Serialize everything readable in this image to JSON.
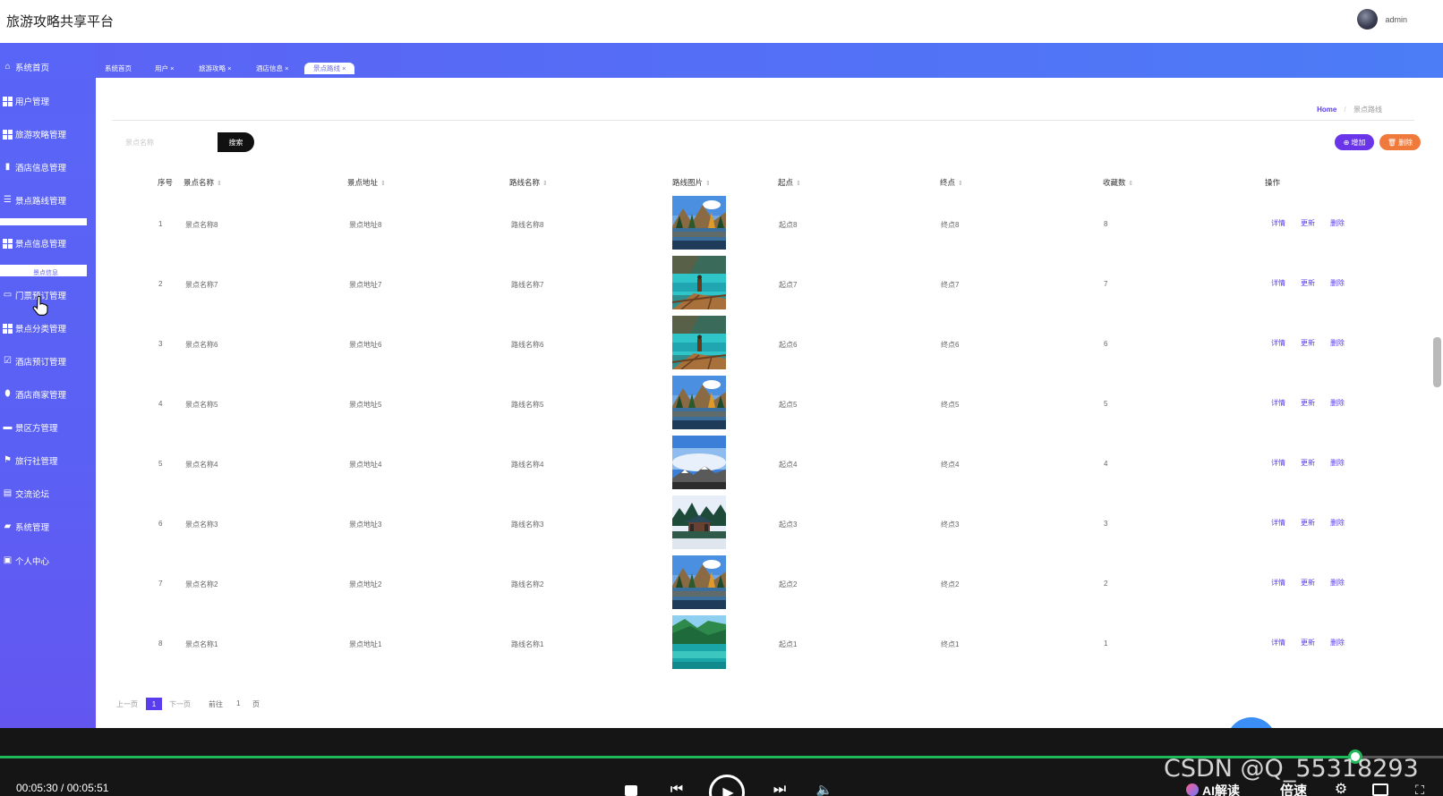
{
  "app": {
    "title": "旅游攻略共享平台",
    "user": "admin"
  },
  "sidebar": {
    "items": [
      {
        "label": "系统首页",
        "icon": "home-icon"
      },
      {
        "label": "用户管理",
        "icon": "grid-icon"
      },
      {
        "label": "旅游攻略管理",
        "icon": "grid-icon"
      },
      {
        "label": "酒店信息管理",
        "icon": "bar-chart-icon"
      },
      {
        "label": "景点路线管理",
        "icon": "list-icon"
      },
      {
        "label": "景点信息管理",
        "icon": "grid-icon"
      },
      {
        "label": "门票预订管理",
        "icon": "monitor-icon"
      },
      {
        "label": "景点分类管理",
        "icon": "grid-icon"
      },
      {
        "label": "酒店预订管理",
        "icon": "clipboard-check-icon"
      },
      {
        "label": "酒店商家管理",
        "icon": "pin-icon"
      },
      {
        "label": "景区方管理",
        "icon": "chair-icon"
      },
      {
        "label": "旅行社管理",
        "icon": "flag-icon"
      },
      {
        "label": "交流论坛",
        "icon": "clipboard-icon"
      },
      {
        "label": "系统管理",
        "icon": "ticket-icon"
      },
      {
        "label": "个人中心",
        "icon": "card-icon"
      }
    ],
    "submenu_label": "景点信息"
  },
  "tabs": [
    {
      "label": "系统首页"
    },
    {
      "label": "用户 ×"
    },
    {
      "label": "旅游攻略 ×"
    },
    {
      "label": "酒店信息 ×"
    },
    {
      "label": "景点路线 ×"
    }
  ],
  "breadcrumb": {
    "home": "Home",
    "separator": "/",
    "current": "景点路线"
  },
  "search": {
    "placeholder": "景点名称",
    "button": "搜索"
  },
  "actions": {
    "add": "增加",
    "delete": "删除"
  },
  "table": {
    "headers": [
      "序号",
      "景点名称",
      "景点地址",
      "路线名称",
      "路线图片",
      "起点",
      "终点",
      "收藏数",
      "操作"
    ],
    "rows": [
      {
        "no": "1",
        "name": "景点名称8",
        "address": "景点地址8",
        "route": "路线名称8",
        "start": "起点8",
        "end": "终点8",
        "favs": "8",
        "image": "lake-mountain-reflection"
      },
      {
        "no": "2",
        "name": "景点名称7",
        "address": "景点地址7",
        "route": "路线名称7",
        "start": "起点7",
        "end": "终点7",
        "favs": "7",
        "image": "turquoise-lake-person"
      },
      {
        "no": "3",
        "name": "景点名称6",
        "address": "景点地址6",
        "route": "路线名称6",
        "start": "起点6",
        "end": "终点6",
        "favs": "6",
        "image": "turquoise-lake-person"
      },
      {
        "no": "4",
        "name": "景点名称5",
        "address": "景点地址5",
        "route": "路线名称5",
        "start": "起点5",
        "end": "终点5",
        "favs": "5",
        "image": "lake-mountain-reflection"
      },
      {
        "no": "5",
        "name": "景点名称4",
        "address": "景点地址4",
        "route": "路线名称4",
        "start": "起点4",
        "end": "终点4",
        "favs": "4",
        "image": "snowy-mountain-sky"
      },
      {
        "no": "6",
        "name": "景点名称3",
        "address": "景点地址3",
        "route": "路线名称3",
        "start": "起点3",
        "end": "终点3",
        "favs": "3",
        "image": "temple-forest"
      },
      {
        "no": "7",
        "name": "景点名称2",
        "address": "景点地址2",
        "route": "路线名称2",
        "start": "起点2",
        "end": "终点2",
        "favs": "2",
        "image": "lake-mountain-reflection"
      },
      {
        "no": "8",
        "name": "景点名称1",
        "address": "景点地址1",
        "route": "路线名称1",
        "start": "起点1",
        "end": "终点1",
        "favs": "1",
        "image": "green-valley-lake"
      }
    ],
    "row_actions": {
      "detail": "详情",
      "update": "更新",
      "delete": "删除"
    }
  },
  "pagination": {
    "prev": "上一页",
    "current": "1",
    "next": "下一页",
    "goto": "前往",
    "goto_value": "1",
    "unit": "页"
  },
  "player": {
    "time": "00:05:30 / 00:05:51",
    "progress": 0.94,
    "ai_label": "AI解读",
    "speed_label": "倍速",
    "watermark": "CSDN @Q_55318293"
  },
  "colors": {
    "sidebar": "#5b60f4",
    "accent": "#5b3df0",
    "add": "#6a34e8",
    "delete": "#f07a3b",
    "progress": "#1fb85a"
  }
}
